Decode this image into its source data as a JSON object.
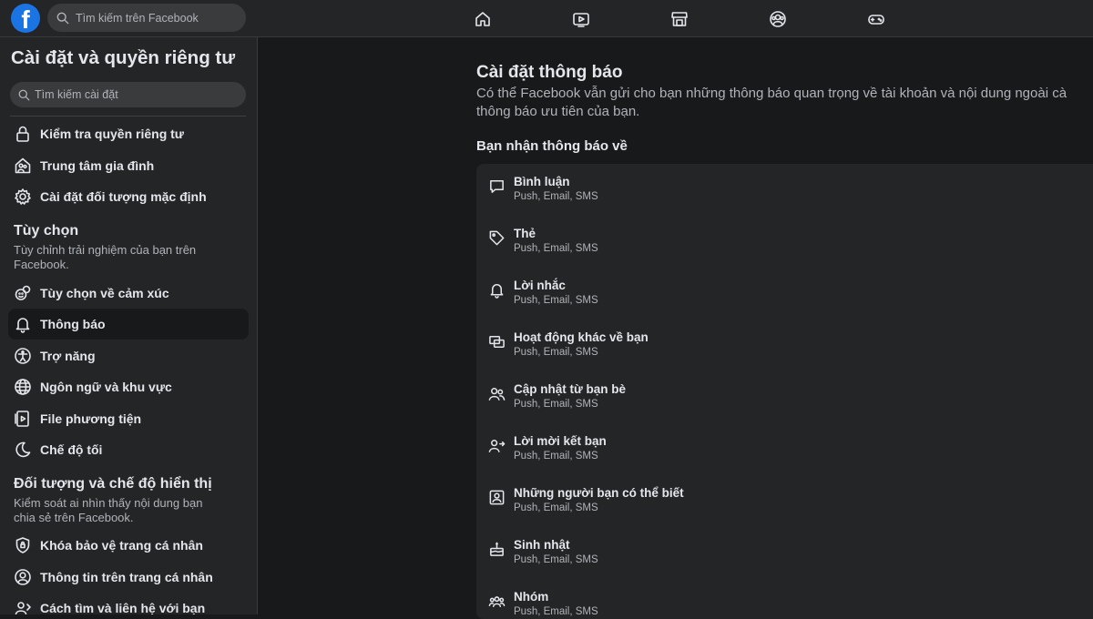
{
  "header": {
    "logo": "f",
    "search_placeholder": "Tìm kiếm trên Facebook",
    "nav": [
      {
        "icon": "home-icon"
      },
      {
        "icon": "video-icon"
      },
      {
        "icon": "marketplace-icon"
      },
      {
        "icon": "groups-icon"
      },
      {
        "icon": "gaming-icon"
      }
    ]
  },
  "sidebar": {
    "title": "Cài đặt và quyền riêng tư",
    "search_placeholder": "Tìm kiếm cài đặt",
    "items_top": [
      {
        "label": "Kiểm tra quyền riêng tư",
        "icon": "lock-icon"
      },
      {
        "label": "Trung tâm gia đình",
        "icon": "family-center-icon"
      },
      {
        "label": "Cài đặt đối tượng mặc định",
        "icon": "gear-icon"
      }
    ],
    "section_preferences": {
      "title": "Tùy chọn",
      "desc": "Tùy chỉnh trải nghiệm của bạn trên Facebook."
    },
    "items_preferences": [
      {
        "label": "Tùy chọn về cảm xúc",
        "icon": "reactions-icon"
      },
      {
        "label": "Thông báo",
        "icon": "bell-icon",
        "active": true
      },
      {
        "label": "Trợ năng",
        "icon": "accessibility-icon"
      },
      {
        "label": "Ngôn ngữ và khu vực",
        "icon": "globe-icon"
      },
      {
        "label": "File phương tiện",
        "icon": "media-file-icon"
      },
      {
        "label": "Chế độ tối",
        "icon": "moon-icon"
      }
    ],
    "section_audience": {
      "title": "Đối tượng và chế độ hiển thị",
      "desc": "Kiểm soát ai nhìn thấy nội dung bạn chia sẻ trên Facebook."
    },
    "items_audience": [
      {
        "label": "Khóa bảo vệ trang cá nhân",
        "icon": "profile-lock-icon"
      },
      {
        "label": "Thông tin trên trang cá nhân",
        "icon": "profile-info-icon"
      },
      {
        "label": "Cách tìm và liên hệ với bạn",
        "icon": "find-contact-icon"
      }
    ]
  },
  "main": {
    "title": "Cài đặt thông báo",
    "desc_line1": "Có thể Facebook vẫn gửi cho bạn những thông báo quan trọng về tài khoản và nội dung ngoài cà",
    "desc_line2": "thông báo ưu tiên của bạn.",
    "subheading": "Bạn nhận thông báo về",
    "notifications": [
      {
        "label": "Bình luận",
        "channels": "Push, Email, SMS",
        "icon": "comment-icon"
      },
      {
        "label": "Thẻ",
        "channels": "Push, Email, SMS",
        "icon": "tag-icon"
      },
      {
        "label": "Lời nhắc",
        "channels": "Push, Email, SMS",
        "icon": "reminder-bell-icon"
      },
      {
        "label": "Hoạt động khác về bạn",
        "channels": "Push, Email, SMS",
        "icon": "activity-icon"
      },
      {
        "label": "Cập nhật từ bạn bè",
        "channels": "Push, Email, SMS",
        "icon": "friends-update-icon"
      },
      {
        "label": "Lời mời kết bạn",
        "channels": "Push, Email, SMS",
        "icon": "friend-request-icon"
      },
      {
        "label": "Những người bạn có thể biết",
        "channels": "Push, Email, SMS",
        "icon": "people-you-may-know-icon"
      },
      {
        "label": "Sinh nhật",
        "channels": "Push, Email, SMS",
        "icon": "birthday-cake-icon"
      },
      {
        "label": "Nhóm",
        "channels": "Push, Email, SMS",
        "icon": "groups-icon"
      }
    ]
  }
}
